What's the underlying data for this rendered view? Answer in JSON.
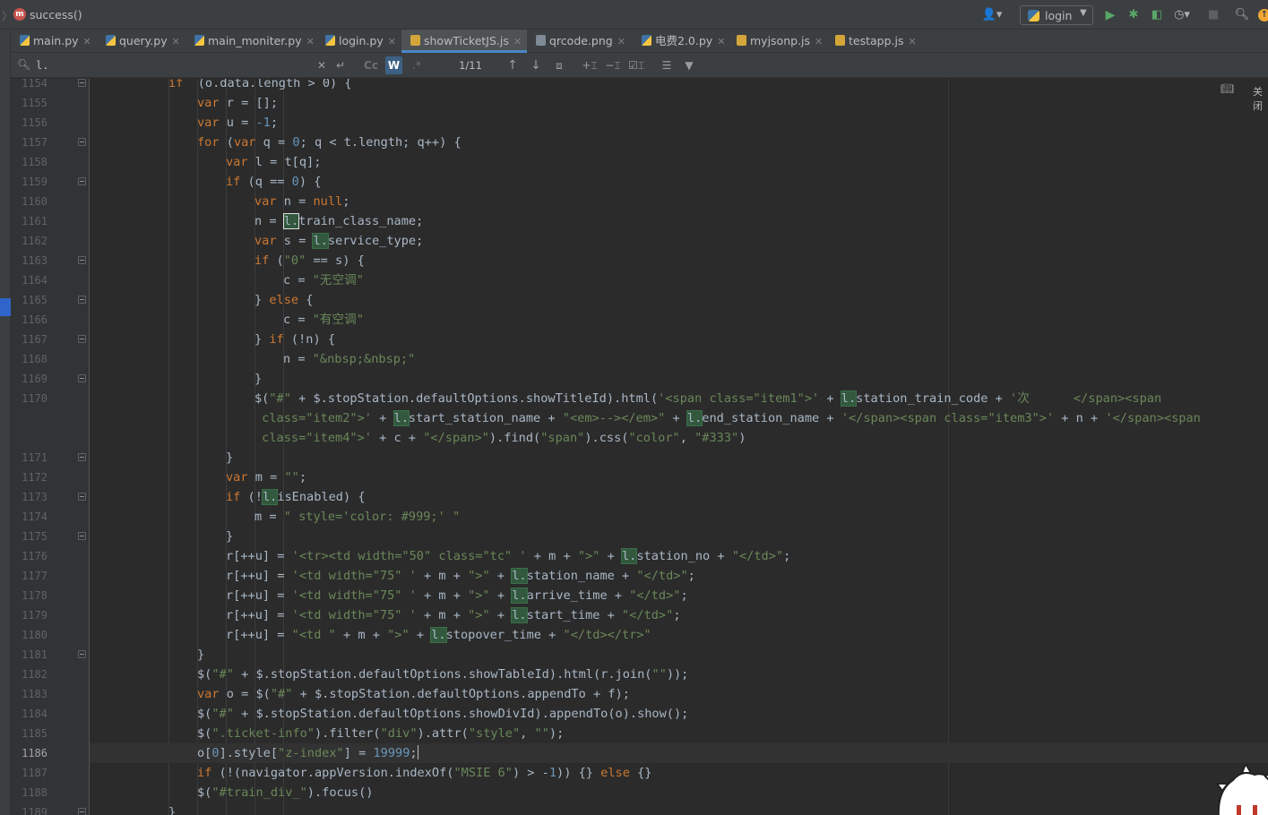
{
  "navbar": {
    "breadcrumb_icon": "m",
    "breadcrumb": "success()",
    "run_config": "login",
    "icons": [
      "user-icon",
      "run-icon",
      "debug-icon",
      "coverage-icon",
      "profile-icon",
      "stop-icon",
      "search-icon",
      "update-icon"
    ]
  },
  "tabs": [
    {
      "label": "main.py",
      "type": "py",
      "active": false
    },
    {
      "label": "query.py",
      "type": "py",
      "active": false
    },
    {
      "label": "main_moniter.py",
      "type": "py",
      "active": false
    },
    {
      "label": "login.py",
      "type": "py",
      "active": false
    },
    {
      "label": "showTicketJS.js",
      "type": "js",
      "active": true
    },
    {
      "label": "qrcode.png",
      "type": "png",
      "active": false
    },
    {
      "label": "电费2.0.py",
      "type": "py",
      "active": false
    },
    {
      "label": "myjsonp.js",
      "type": "js",
      "active": false
    },
    {
      "label": "testapp.js",
      "type": "js",
      "active": false
    }
  ],
  "find": {
    "query": "l.",
    "match_count": "1/11",
    "match_case_label": "Cc",
    "whole_word_label": "W",
    "regex_label": ".*"
  },
  "editor": {
    "right_panel_label": "关闭",
    "current_line": 1186,
    "lines": [
      {
        "n": "1154",
        "indent": 6,
        "fold": true,
        "tokens": [
          [
            "kw",
            "if"
          ],
          [
            "",
            "  (o.data.length > 0) {"
          ]
        ]
      },
      {
        "n": "1155",
        "indent": 8,
        "tokens": [
          [
            "kw",
            "var"
          ],
          [
            "",
            " r = [];"
          ]
        ]
      },
      {
        "n": "1156",
        "indent": 8,
        "tokens": [
          [
            "kw",
            "var"
          ],
          [
            "",
            " u = "
          ],
          [
            "num",
            "-1"
          ],
          [
            "",
            ";"
          ]
        ]
      },
      {
        "n": "1157",
        "indent": 8,
        "fold": true,
        "tokens": [
          [
            "kw",
            "for"
          ],
          [
            "",
            " ("
          ],
          [
            "kw",
            "var"
          ],
          [
            "",
            " q = "
          ],
          [
            "num",
            "0"
          ],
          [
            "",
            "; q < t.length; q++) {"
          ]
        ]
      },
      {
        "n": "1158",
        "indent": 10,
        "tokens": [
          [
            "kw",
            "var"
          ],
          [
            "",
            " l = t[q];"
          ]
        ]
      },
      {
        "n": "1159",
        "indent": 10,
        "fold": true,
        "tokens": [
          [
            "kw",
            "if"
          ],
          [
            "",
            " (q == "
          ],
          [
            "num",
            "0"
          ],
          [
            "",
            ") {"
          ]
        ]
      },
      {
        "n": "1160",
        "indent": 12,
        "tokens": [
          [
            "kw",
            "var"
          ],
          [
            "",
            " n = "
          ],
          [
            "kw",
            "null"
          ],
          [
            "",
            ";"
          ]
        ]
      },
      {
        "n": "1161",
        "indent": 12,
        "tokens": [
          [
            "",
            "n = "
          ],
          [
            "hl-cur",
            "l."
          ],
          [
            "",
            "train_class_name;"
          ]
        ]
      },
      {
        "n": "1162",
        "indent": 12,
        "tokens": [
          [
            "kw",
            "var"
          ],
          [
            "",
            " s = "
          ],
          [
            "hl",
            "l."
          ],
          [
            "",
            "service_type;"
          ]
        ]
      },
      {
        "n": "1163",
        "indent": 12,
        "fold": true,
        "tokens": [
          [
            "kw",
            "if"
          ],
          [
            "",
            " ("
          ],
          [
            "str",
            "\"0\""
          ],
          [
            "",
            " == s) {"
          ]
        ]
      },
      {
        "n": "1164",
        "indent": 14,
        "tokens": [
          [
            "",
            "c = "
          ],
          [
            "str",
            "\"无空调\""
          ]
        ]
      },
      {
        "n": "1165",
        "indent": 12,
        "fold": true,
        "tokens": [
          [
            "",
            "} "
          ],
          [
            "kw",
            "else"
          ],
          [
            "",
            " {"
          ]
        ]
      },
      {
        "n": "1166",
        "indent": 14,
        "tokens": [
          [
            "",
            "c = "
          ],
          [
            "str",
            "\"有空调\""
          ]
        ]
      },
      {
        "n": "1167",
        "indent": 12,
        "fold": true,
        "tokens": [
          [
            "",
            "} "
          ],
          [
            "kw",
            "if"
          ],
          [
            "",
            " (!n) {"
          ]
        ]
      },
      {
        "n": "1168",
        "indent": 14,
        "tokens": [
          [
            "",
            "n = "
          ],
          [
            "str",
            "\"&nbsp;&nbsp;\""
          ]
        ]
      },
      {
        "n": "1169",
        "indent": 12,
        "fold": true,
        "tokens": [
          [
            "",
            "}"
          ]
        ]
      },
      {
        "n": "1170",
        "indent": 12,
        "tokens": [
          [
            "",
            "$("
          ],
          [
            "str",
            "\"#\""
          ],
          [
            "",
            " + $.stopStation.defaultOptions.showTitleId).html("
          ],
          [
            "str",
            "'<span class=\"item1\">'"
          ],
          [
            "",
            " + "
          ],
          [
            "hl",
            "l."
          ],
          [
            "",
            "station_train_code + "
          ],
          [
            "str",
            "'次      </span><span"
          ]
        ]
      },
      {
        "n": "",
        "indent": 12,
        "tokens": [
          [
            "str",
            " class=\"item2\">'"
          ],
          [
            "",
            " + "
          ],
          [
            "hl",
            "l."
          ],
          [
            "",
            "start_station_name + "
          ],
          [
            "str",
            "\"<em>--></em>\""
          ],
          [
            "",
            " + "
          ],
          [
            "hl",
            "l."
          ],
          [
            "",
            "end_station_name + "
          ],
          [
            "str",
            "'</span><span class=\"item3\">'"
          ],
          [
            "",
            " + n + "
          ],
          [
            "str",
            "'</span><span"
          ]
        ]
      },
      {
        "n": "",
        "indent": 12,
        "tokens": [
          [
            "str",
            " class=\"item4\">'"
          ],
          [
            "",
            " + c + "
          ],
          [
            "str",
            "\"</span>\""
          ],
          [
            "",
            ").find("
          ],
          [
            "str",
            "\"span\""
          ],
          [
            "",
            ").css("
          ],
          [
            "str",
            "\"color\""
          ],
          [
            "",
            ", "
          ],
          [
            "str",
            "\"#333\""
          ],
          [
            "",
            ")"
          ]
        ]
      },
      {
        "n": "1171",
        "indent": 10,
        "fold": true,
        "tokens": [
          [
            "",
            "}"
          ]
        ]
      },
      {
        "n": "1172",
        "indent": 10,
        "tokens": [
          [
            "kw",
            "var"
          ],
          [
            "",
            " m = "
          ],
          [
            "str",
            "\"\""
          ],
          [
            "",
            ";"
          ]
        ]
      },
      {
        "n": "1173",
        "indent": 10,
        "fold": true,
        "tokens": [
          [
            "kw",
            "if"
          ],
          [
            "",
            " (!"
          ],
          [
            "hl",
            "l."
          ],
          [
            "",
            "isEnabled) {"
          ]
        ]
      },
      {
        "n": "1174",
        "indent": 12,
        "tokens": [
          [
            "",
            "m = "
          ],
          [
            "str",
            "\" style='color: #999;' \""
          ]
        ]
      },
      {
        "n": "1175",
        "indent": 10,
        "fold": true,
        "tokens": [
          [
            "",
            "}"
          ]
        ]
      },
      {
        "n": "1176",
        "indent": 10,
        "tokens": [
          [
            "",
            "r[++u] = "
          ],
          [
            "str",
            "'<tr><td width=\"50\" class=\"tc\" '"
          ],
          [
            "",
            " + m + "
          ],
          [
            "str",
            "\">\""
          ],
          [
            "",
            " + "
          ],
          [
            "hl",
            "l."
          ],
          [
            "",
            "station_no + "
          ],
          [
            "str",
            "\"</td>\""
          ],
          [
            "",
            ";"
          ]
        ]
      },
      {
        "n": "1177",
        "indent": 10,
        "tokens": [
          [
            "",
            "r[++u] = "
          ],
          [
            "str",
            "'<td width=\"75\" '"
          ],
          [
            "",
            " + m + "
          ],
          [
            "str",
            "\">\""
          ],
          [
            "",
            " + "
          ],
          [
            "hl",
            "l."
          ],
          [
            "",
            "station_name + "
          ],
          [
            "str",
            "\"</td>\""
          ],
          [
            "",
            ";"
          ]
        ]
      },
      {
        "n": "1178",
        "indent": 10,
        "tokens": [
          [
            "",
            "r[++u] = "
          ],
          [
            "str",
            "'<td width=\"75\" '"
          ],
          [
            "",
            " + m + "
          ],
          [
            "str",
            "\">\""
          ],
          [
            "",
            " + "
          ],
          [
            "hl",
            "l."
          ],
          [
            "",
            "arrive_time + "
          ],
          [
            "str",
            "\"</td>\""
          ],
          [
            "",
            ";"
          ]
        ]
      },
      {
        "n": "1179",
        "indent": 10,
        "tokens": [
          [
            "",
            "r[++u] = "
          ],
          [
            "str",
            "'<td width=\"75\" '"
          ],
          [
            "",
            " + m + "
          ],
          [
            "str",
            "\">\""
          ],
          [
            "",
            " + "
          ],
          [
            "hl",
            "l."
          ],
          [
            "",
            "start_time + "
          ],
          [
            "str",
            "\"</td>\""
          ],
          [
            "",
            ";"
          ]
        ]
      },
      {
        "n": "1180",
        "indent": 10,
        "tokens": [
          [
            "",
            "r[++u] = "
          ],
          [
            "str",
            "\"<td \""
          ],
          [
            "",
            " + m + "
          ],
          [
            "str",
            "\">\""
          ],
          [
            "",
            " + "
          ],
          [
            "hl",
            "l."
          ],
          [
            "",
            "stopover_time + "
          ],
          [
            "str",
            "\"</td></tr>\""
          ]
        ]
      },
      {
        "n": "1181",
        "indent": 8,
        "fold": true,
        "tokens": [
          [
            "",
            "}"
          ]
        ]
      },
      {
        "n": "1182",
        "indent": 8,
        "tokens": [
          [
            "",
            "$("
          ],
          [
            "str",
            "\"#\""
          ],
          [
            "",
            " + $.stopStation.defaultOptions.showTableId).html(r.join("
          ],
          [
            "str",
            "\"\""
          ],
          [
            "",
            "));"
          ]
        ]
      },
      {
        "n": "1183",
        "indent": 8,
        "tokens": [
          [
            "kw",
            "var"
          ],
          [
            "",
            " o = $("
          ],
          [
            "str",
            "\"#\""
          ],
          [
            "",
            " + $.stopStation.defaultOptions.appendTo + f);"
          ]
        ]
      },
      {
        "n": "1184",
        "indent": 8,
        "tokens": [
          [
            "",
            "$("
          ],
          [
            "str",
            "\"#\""
          ],
          [
            "",
            " + $.stopStation.defaultOptions.showDivId).appendTo(o).show();"
          ]
        ]
      },
      {
        "n": "1185",
        "indent": 8,
        "tokens": [
          [
            "",
            "$("
          ],
          [
            "str",
            "\".ticket-info\""
          ],
          [
            "",
            ").filter("
          ],
          [
            "str",
            "\"div\""
          ],
          [
            "",
            ").attr("
          ],
          [
            "str",
            "\"style\""
          ],
          [
            "",
            ", "
          ],
          [
            "str",
            "\"\""
          ],
          [
            "",
            ");"
          ]
        ]
      },
      {
        "n": "1186",
        "indent": 8,
        "current": true,
        "tokens": [
          [
            "",
            "o["
          ],
          [
            "num",
            "0"
          ],
          [
            "",
            "].style["
          ],
          [
            "str",
            "\"z-index\""
          ],
          [
            "",
            "] = "
          ],
          [
            "num",
            "19999"
          ],
          [
            "",
            ";"
          ],
          [
            "caret",
            ""
          ]
        ]
      },
      {
        "n": "1187",
        "indent": 8,
        "tokens": [
          [
            "kw",
            "if"
          ],
          [
            "",
            " (!(navigator.appVersion.indexOf("
          ],
          [
            "str",
            "\"MSIE 6\""
          ],
          [
            "",
            ") > -"
          ],
          [
            "num",
            "1"
          ],
          [
            "",
            ")) {} "
          ],
          [
            "kw",
            "else"
          ],
          [
            "",
            " {}"
          ]
        ]
      },
      {
        "n": "1188",
        "indent": 8,
        "tokens": [
          [
            "",
            "$("
          ],
          [
            "str",
            "\"#train_div_\""
          ],
          [
            "",
            ").focus()"
          ]
        ]
      },
      {
        "n": "1189",
        "indent": 6,
        "fold": true,
        "tokens": [
          [
            "",
            "}"
          ]
        ]
      }
    ]
  }
}
